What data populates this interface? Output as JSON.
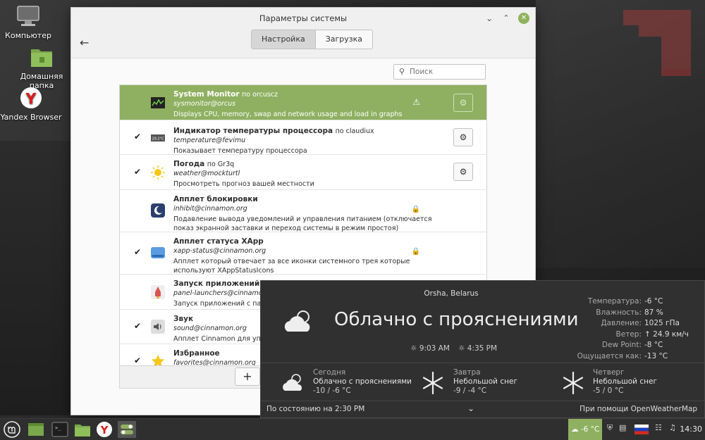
{
  "desktop": {
    "icons": [
      {
        "label": "Компьютер"
      },
      {
        "label": "Домашняя папка"
      },
      {
        "label": "Yandex Browser"
      }
    ]
  },
  "window": {
    "title": "Параметры системы",
    "tabs": [
      {
        "label": "Настройка"
      },
      {
        "label": "Загрузка"
      }
    ],
    "search_placeholder": "Поиск",
    "applets": [
      {
        "name": "System Monitor",
        "author": "по orcuscz",
        "uuid": "sysmonitor@orcus",
        "desc": "Displays CPU, memory, swap and network usage and load in graphs",
        "checked": false,
        "selected": true
      },
      {
        "name": "Индикатор температуры процессора",
        "author": "по claudiux",
        "uuid": "temperature@fevimu",
        "desc": "Показывает температуру процессора",
        "checked": true,
        "icon_text": "29.2°C"
      },
      {
        "name": "Погода",
        "author": "по Gr3q",
        "uuid": "weather@mockturtl",
        "desc": "Просмотреть прогноз вашей местности",
        "checked": true
      },
      {
        "name": "Апплет блокировки",
        "author": "",
        "uuid": "inhibit@cinnamon.org",
        "desc": "Подавление вывода уведомлений и управления питанием (отключается показ экранной заставки и переход системы в режим простоя)",
        "checked": false
      },
      {
        "name": "Апплет статуса XApp",
        "author": "",
        "uuid": "xapp-status@cinnamon.org",
        "desc": "Апплет который отвечает за все иконки системного трея которые используют XAppStatusIcons",
        "checked": true
      },
      {
        "name": "Запуск приложений с па",
        "author": "",
        "uuid": "panel-launchers@cinnamon.org",
        "desc": "Запуск приложений с панели",
        "checked": false
      },
      {
        "name": "Звук",
        "author": "",
        "uuid": "sound@cinnamon.org",
        "desc": "Апплет Cinnamon для управле",
        "checked": true
      },
      {
        "name": "Избранное",
        "author": "",
        "uuid": "favorites@cinnamon.org",
        "desc": "",
        "checked": true
      }
    ],
    "add_label": "+"
  },
  "weather": {
    "location": "Orsha, Belarus",
    "condition": "Облачно с прояснениями",
    "sunrise": "9:03 AM",
    "sunset": "4:35 PM",
    "details": [
      {
        "label": "Температура:",
        "value": "-6 °C"
      },
      {
        "label": "Влажность:",
        "value": "87 %"
      },
      {
        "label": "Давление:",
        "value": "1025 гПа"
      },
      {
        "label": "Ветер:",
        "value": "↑ 24.9 км/ч"
      },
      {
        "label": "Dew Point:",
        "value": "-8 °C"
      },
      {
        "label": "Ощущается как:",
        "value": "-13 °C"
      }
    ],
    "forecast": [
      {
        "day": "Сегодня",
        "cond": "Облачно с прояснениями",
        "temp": "-10 / -6 °C",
        "icon": "cloud-sun-icon"
      },
      {
        "day": "Завтра",
        "cond": "Небольшой снег",
        "temp": "-9 / -4 °C",
        "icon": "snowflake-icon"
      },
      {
        "day": "Четверг",
        "cond": "Небольшой снег",
        "temp": "-5 / 0 °C",
        "icon": "snowflake-icon"
      }
    ],
    "status": "По состоянию на 2:30 PM",
    "provider": "При помощи OpenWeatherMap"
  },
  "panel": {
    "weather_applet": "-6 °C",
    "clock": "14:30"
  }
}
